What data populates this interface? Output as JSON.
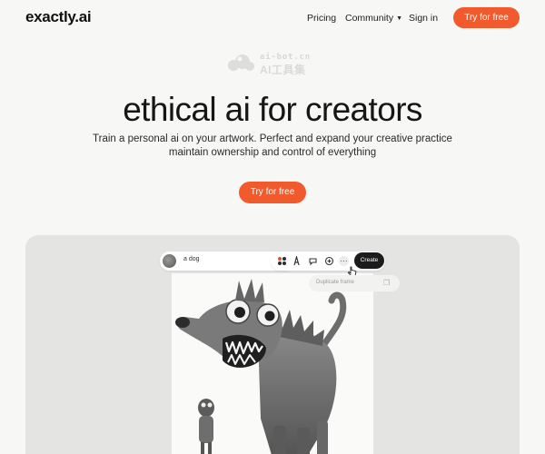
{
  "nav": {
    "logo": "exactly.ai",
    "links": [
      "Pricing",
      "Community",
      "Sign in"
    ],
    "cta": "Try for free"
  },
  "watermark": {
    "top": "ai-bot.cn",
    "bottom": "AI工具集"
  },
  "hero": {
    "title": "ethical ai for creators",
    "subtitle_line1": "Train a personal ai on your artwork. Perfect and expand your creative practice",
    "subtitle_line2": "maintain ownership and control of everything",
    "cta": "Try for free"
  },
  "demo": {
    "prompt_text": "a dog",
    "create_label": "Create",
    "tooltip": "Duplicate frame",
    "colors": {
      "accent": "#f05a2c",
      "dark": "#1c1c1c",
      "panel": "#e4e4e3"
    }
  }
}
